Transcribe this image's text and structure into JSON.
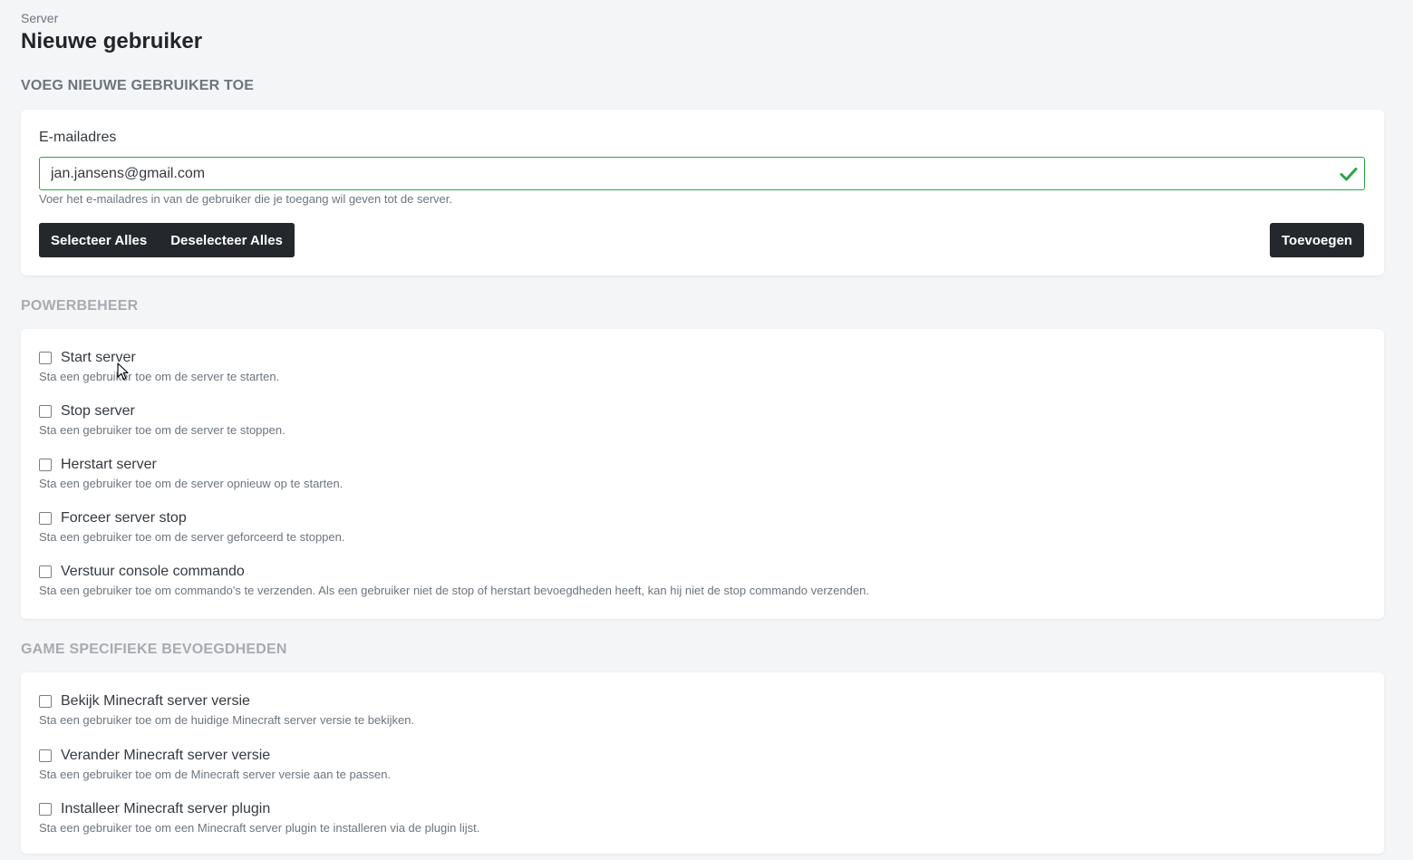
{
  "breadcrumb": "Server",
  "page_title": "Nieuwe gebruiker",
  "add_user": {
    "heading": "VOEG NIEUWE GEBRUIKER TOE",
    "email_label": "E-mailadres",
    "email_value": "jan.jansens@gmail.com",
    "email_help": "Voer het e-mailadres in van de gebruiker die je toegang wil geven tot de server.",
    "select_all": "Selecteer Alles",
    "deselect_all": "Deselecteer Alles",
    "add_button": "Toevoegen",
    "valid_color": "#28a745"
  },
  "power": {
    "heading": "POWERBEHEER",
    "items": [
      {
        "label": "Start server",
        "desc": "Sta een gebruiker toe om de server te starten.",
        "checked": false
      },
      {
        "label": "Stop server",
        "desc": "Sta een gebruiker toe om de server te stoppen.",
        "checked": false
      },
      {
        "label": "Herstart server",
        "desc": "Sta een gebruiker toe om de server opnieuw op te starten.",
        "checked": false
      },
      {
        "label": "Forceer server stop",
        "desc": "Sta een gebruiker toe om de server geforceerd te stoppen.",
        "checked": false
      },
      {
        "label": "Verstuur console commando",
        "desc": "Sta een gebruiker toe om commando's te verzenden. Als een gebruiker niet de stop of herstart bevoegdheden heeft, kan hij niet de stop commando verzenden.",
        "checked": false
      }
    ]
  },
  "game": {
    "heading": "GAME SPECIFIEKE BEVOEGDHEDEN",
    "items": [
      {
        "label": "Bekijk Minecraft server versie",
        "desc": "Sta een gebruiker toe om de huidige Minecraft server versie te bekijken.",
        "checked": false
      },
      {
        "label": "Verander Minecraft server versie",
        "desc": "Sta een gebruiker toe om de Minecraft server versie aan te passen.",
        "checked": false
      },
      {
        "label": "Installeer Minecraft server plugin",
        "desc": "Sta een gebruiker toe om een Minecraft server plugin te installeren via de plugin lijst.",
        "checked": false
      }
    ]
  }
}
